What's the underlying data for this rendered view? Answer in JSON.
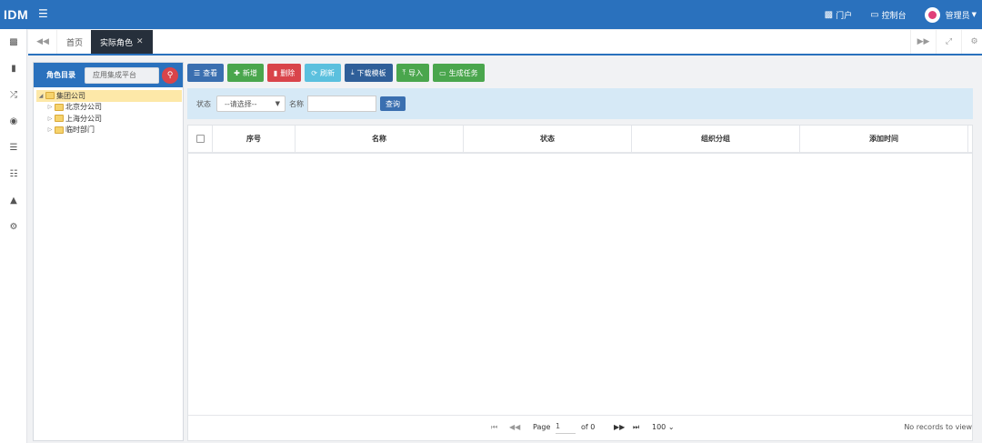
{
  "header": {
    "logo": "IDM",
    "menu_icon": "hamburger-icon",
    "portal_label": "门户",
    "console_label": "控制台",
    "user_label": "管理员"
  },
  "sidenav": {
    "icons": [
      "id-card-icon",
      "book-icon",
      "shuffle-icon",
      "eye-icon",
      "list-icon",
      "sitemap-icon",
      "area-chart-icon",
      "gears-icon"
    ]
  },
  "tabs": {
    "home_label": "首页",
    "active_label": "实际角色"
  },
  "tree": {
    "header_label": "角色目录",
    "search_value": "应用集成平台",
    "nodes": [
      {
        "label": "集团公司",
        "level": 0,
        "selected": true
      },
      {
        "label": "北京分公司",
        "level": 1,
        "selected": false
      },
      {
        "label": "上海分公司",
        "level": 1,
        "selected": false
      },
      {
        "label": "临时部门",
        "level": 1,
        "selected": false
      }
    ]
  },
  "toolbar": {
    "view_label": "查看",
    "add_label": "新增",
    "delete_label": "删除",
    "refresh_label": "刷新",
    "download_label": "下载模板",
    "import_label": "导入",
    "generate_label": "生成任务"
  },
  "filter": {
    "status_label": "状态",
    "status_value": "--请选择--",
    "name_label": "名称",
    "name_value": "",
    "query_label": "查询"
  },
  "grid": {
    "columns": [
      "序号",
      "名称",
      "状态",
      "组织分组",
      "添加时间"
    ],
    "rows": []
  },
  "pager": {
    "page_label": "Page",
    "page_value": "1",
    "of_label": "of 0",
    "page_size": "100",
    "status_text": "No records to view"
  }
}
